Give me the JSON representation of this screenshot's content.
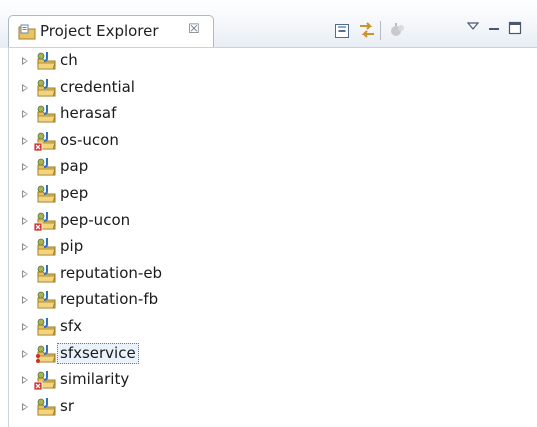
{
  "view": {
    "title": "Project Explorer",
    "close_glyph": "☒"
  },
  "toolbar": {
    "icons": [
      "collapse-all-icon",
      "link-with-editor-icon",
      "focus-icon",
      "view-menu-icon",
      "minimize-icon",
      "maximize-icon"
    ]
  },
  "tree": {
    "items": [
      {
        "label": "ch",
        "error": false,
        "selected": false
      },
      {
        "label": "credential",
        "error": false,
        "selected": false
      },
      {
        "label": "herasaf",
        "error": false,
        "selected": false
      },
      {
        "label": "os-ucon",
        "error": true,
        "selected": false
      },
      {
        "label": "pap",
        "error": false,
        "selected": false
      },
      {
        "label": "pep",
        "error": false,
        "selected": false
      },
      {
        "label": "pep-ucon",
        "error": true,
        "selected": false
      },
      {
        "label": "pip",
        "error": false,
        "selected": false
      },
      {
        "label": "reputation-eb",
        "error": false,
        "selected": false
      },
      {
        "label": "reputation-fb",
        "error": false,
        "selected": false
      },
      {
        "label": "sfx",
        "error": false,
        "selected": false
      },
      {
        "label": "sfxservice",
        "error": false,
        "selected": true
      },
      {
        "label": "similarity",
        "error": true,
        "selected": false
      },
      {
        "label": "sr",
        "error": false,
        "selected": false
      }
    ]
  },
  "colors": {
    "error_marker": "#d42b2b",
    "java_j": "#2f6fc2",
    "folder": "#e6c15a"
  }
}
